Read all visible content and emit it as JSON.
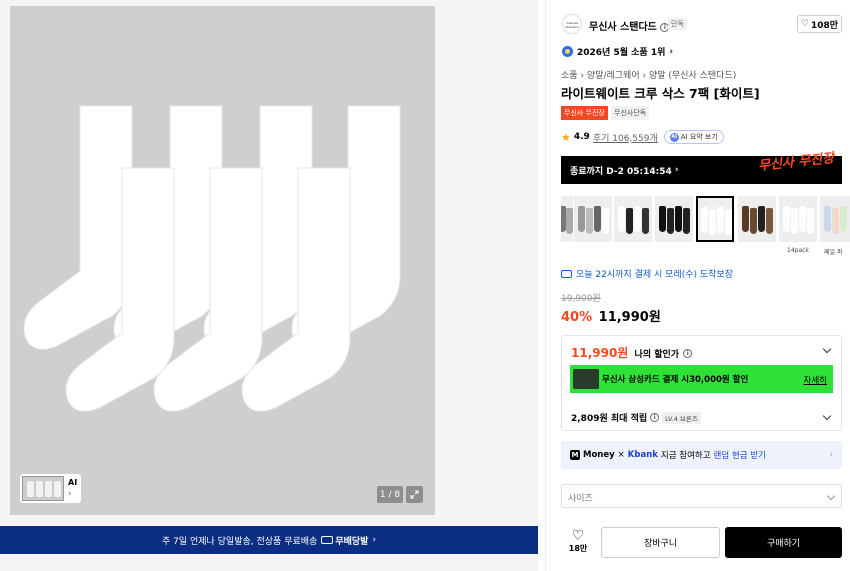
{
  "gallery": {
    "page_counter": "1 / 8",
    "thumb_label": "AI",
    "shipping_banner": "주 7일 언제나 당일발송, 전상품 무료배송",
    "shipping_badge": "무배당발"
  },
  "brand": {
    "name": "무신사 스탠다드",
    "logo_text": "musinsa standard",
    "tag": "단독",
    "likes": "108만"
  },
  "rank": "2026년 5월 소품 1위",
  "breadcrumb": [
    "소품",
    "양말/레그웨어",
    "양말 (무신사 스탠다드)"
  ],
  "title": "라이트웨이트 크루 삭스 7팩 [화이트]",
  "tags": [
    "무신사 무진장",
    "무신사단독"
  ],
  "rating": {
    "score": "4.9",
    "reviews": "후기 106,559개",
    "ai_summary": "AI 요약 보기"
  },
  "promo": {
    "countdown": "종료까지 D-2 05:14:54",
    "logo": "무신사 무진장"
  },
  "options": {
    "labels": [
      "14pack",
      "페일 파"
    ]
  },
  "delivery": "오늘 22시까지 결제 시 모레(수) 도착보장",
  "price": {
    "original": "19,900원",
    "discount": "40%",
    "sale": "11,990원"
  },
  "benefit": {
    "my_price": "11,990원",
    "my_price_label": "나의 할인가",
    "card_text_pre": "무신사 삼성카드 결제 시 ",
    "card_amount": "30,000원 할인",
    "card_link": "자세히",
    "points": "2,809원 최대 적립",
    "level": "LV.4 브론즈"
  },
  "kbank": {
    "money": "Money",
    "times": "×",
    "brand": "Kbank",
    "text": "지금 참여하고",
    "link": "랜덤 현금 받기"
  },
  "size_placeholder": "사이즈",
  "actions": {
    "likes": "18만",
    "cart": "장바구니",
    "buy": "구매하기"
  },
  "colors": {
    "accent_red": "#f24920",
    "banner_navy": "#0b2d82",
    "card_green": "#2fe036",
    "link_blue": "#0b5bd3"
  }
}
